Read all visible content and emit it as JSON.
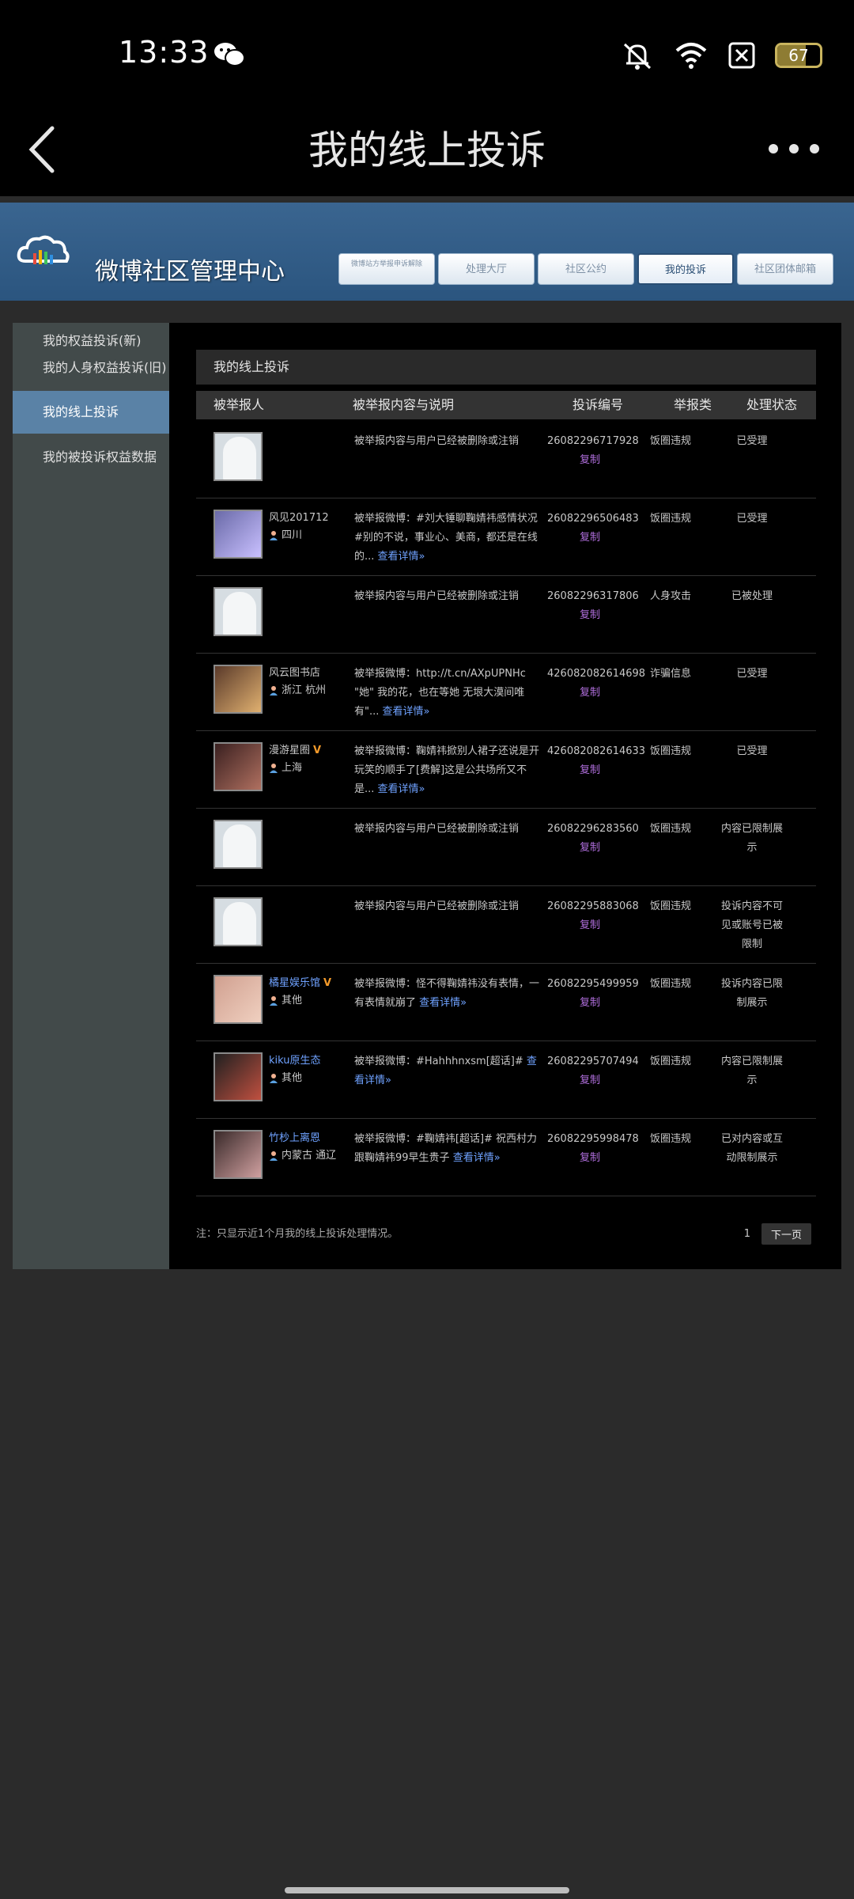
{
  "status_bar": {
    "time": "13:33",
    "battery": "67",
    "battery_level": 0.67
  },
  "titlebar": {
    "title": "我的线上投诉"
  },
  "header": {
    "site_title": "微博社区管理中心",
    "tabs": [
      {
        "label": "微博站方举报申诉解除",
        "active": false
      },
      {
        "label": "处理大厅",
        "active": false
      },
      {
        "label": "社区公约",
        "active": false
      },
      {
        "label": "我的投诉",
        "active": true
      },
      {
        "label": "社区团体邮箱",
        "active": false
      }
    ]
  },
  "sidebar": {
    "items": [
      {
        "label": "我的权益投诉(新)"
      },
      {
        "label": "我的人身权益投诉(旧)"
      },
      {
        "label": "我的线上投诉"
      },
      {
        "label": "我的被投诉权益数据"
      }
    ]
  },
  "main": {
    "section_title": "我的线上投诉",
    "columns": {
      "reported": "被举报人",
      "content": "被举报内容与说明",
      "number": "投诉编号",
      "category": "举报类",
      "status": "处理状态"
    },
    "rows": [
      {
        "avatar": "blank",
        "name": "",
        "vip": false,
        "location": "",
        "content": "被举报内容与用户已经被删除或注销",
        "more": "",
        "number": "26082296717928",
        "copy": "复制",
        "category": "饭圈违规",
        "status": "已受理"
      },
      {
        "avatar": "photo",
        "name": "风见201712",
        "vip": false,
        "location": "四川",
        "content": "被举报微博：#刘大锤聊鞠婧祎感情状况#别的不说，事业心、美商，都还是在线的...",
        "more": "查看详情»",
        "number": "26082296506483",
        "copy": "复制",
        "category": "饭圈违规",
        "status": "已受理"
      },
      {
        "avatar": "blank",
        "name": "",
        "vip": false,
        "location": "",
        "content": "被举报内容与用户已经被删除或注销",
        "more": "",
        "number": "26082296317806",
        "copy": "复制",
        "category": "人身攻击",
        "status": "已被处理"
      },
      {
        "avatar": "photo",
        "name": "风云图书店",
        "vip": false,
        "location": "浙江 杭州",
        "content": "被举报微博：http://t.cn/AXpUPNHc \"她\" 我的花，也在等她 无垠大漠间唯有\"...",
        "more": "查看详情»",
        "number": "426082082614698",
        "copy": "复制",
        "category": "诈骗信息",
        "status": "已受理"
      },
      {
        "avatar": "photo",
        "name": "漫游星圈",
        "vip": true,
        "location": "上海",
        "content": "被举报微博：鞠婧祎掀别人裙子还说是开玩笑的顺手了[费解]这是公共场所又不是...",
        "more": "查看详情»",
        "number": "426082082614633",
        "copy": "复制",
        "category": "饭圈违规",
        "status": "已受理"
      },
      {
        "avatar": "blank",
        "name": "",
        "vip": false,
        "location": "",
        "content": "被举报内容与用户已经被删除或注销",
        "more": "",
        "number": "26082296283560",
        "copy": "复制",
        "category": "饭圈违规",
        "status": "内容已限制展示"
      },
      {
        "avatar": "blank",
        "name": "",
        "vip": false,
        "location": "",
        "content": "被举报内容与用户已经被删除或注销",
        "more": "",
        "number": "26082295883068",
        "copy": "复制",
        "category": "饭圈违规",
        "status": "投诉内容不可见或账号已被限制"
      },
      {
        "avatar": "photo",
        "name": "橘星娱乐馆",
        "vip": true,
        "location": "其他",
        "content": "被举报微博：怪不得鞠婧祎没有表情，一有表情就崩了",
        "more": "查看详情»",
        "number": "26082295499959",
        "copy": "复制",
        "category": "饭圈违规",
        "status": "投诉内容已限制展示"
      },
      {
        "avatar": "photo",
        "name": "kiku原生态",
        "vip": false,
        "location": "其他",
        "content": "被举报微博：#Hahhhnxsm[超话]#",
        "more": "查看详情»",
        "number": "26082295707494",
        "copy": "复制",
        "category": "饭圈违规",
        "status": "内容已限制展示"
      },
      {
        "avatar": "photo",
        "name": "竹杪上离恩",
        "vip": false,
        "location": "内蒙古 通辽",
        "content": "被举报微博：#鞠婧祎[超话]# 祝西村力跟鞠婧祎99早生贵子",
        "more": "查看详情»",
        "number": "26082295998478",
        "copy": "复制",
        "category": "饭圈违规",
        "status": "已对内容或互动限制展示"
      }
    ],
    "footer_note": "注：只显示近1个月我的线上投诉处理情况。",
    "page_number": "1",
    "next_label": "下一页"
  }
}
